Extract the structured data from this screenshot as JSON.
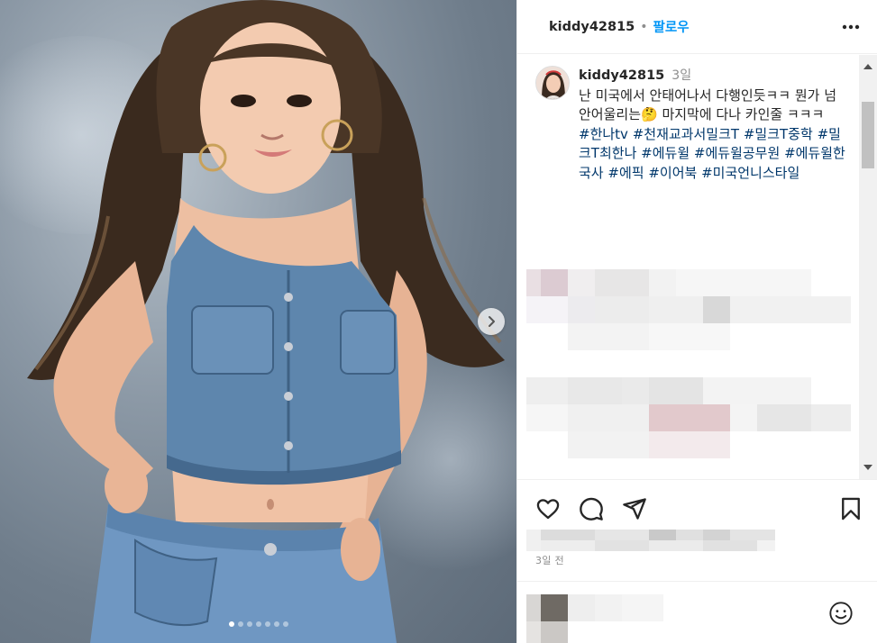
{
  "post": {
    "username": "kiddy42815",
    "follow_label": "팔로우",
    "separator": "•",
    "caption_time": "3일",
    "caption_text": "난 미국에서 안태어나서 다행인듯ㅋㅋ 뭔가 넘 안어울리는🤔 마지막에 다나 카인줄 ㅋㅋㅋ",
    "hashtags": [
      "#한나tv",
      "#천재교과서밀크T",
      "#밀크T중학",
      "#밀크T최한나",
      "#에듀윌",
      "#에듀윌공무원",
      "#에듀윌한국사",
      "#에픽",
      "#이어북",
      "#미국언니스타일"
    ],
    "posted_ago": "3일 전"
  },
  "carousel": {
    "slide_count": 7,
    "active_index": 0
  },
  "icons": {
    "more": "more-horizontal-icon",
    "next": "chevron-right-icon",
    "like": "heart-icon",
    "comment": "speech-bubble-icon",
    "share": "paper-plane-icon",
    "save": "bookmark-icon",
    "emoji": "smiley-icon"
  },
  "colors": {
    "accent": "#0095f6",
    "hashtag": "#00376b",
    "muted": "#8e8e8e"
  }
}
